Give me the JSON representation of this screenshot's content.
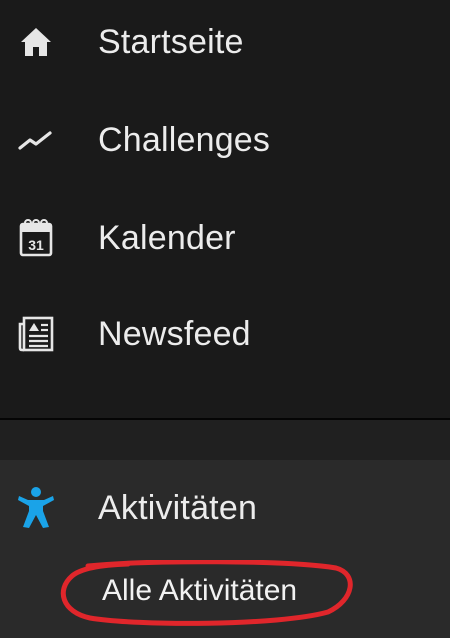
{
  "nav": {
    "items": [
      {
        "label": "Startseite",
        "icon": "home-icon"
      },
      {
        "label": "Challenges",
        "icon": "activity-line-icon"
      },
      {
        "label": "Kalender",
        "icon": "calendar-icon",
        "icon_text": "31"
      },
      {
        "label": "Newsfeed",
        "icon": "newsfeed-icon"
      }
    ]
  },
  "section": {
    "label": "Aktivitäten",
    "icon": "person-activity-icon",
    "icon_color": "#1aa3e8",
    "sub_items": [
      {
        "label": "Alle Aktivitäten"
      }
    ]
  },
  "annotation": {
    "color": "#e0262b"
  },
  "colors": {
    "background_top": "#1a1a1a",
    "background_section": "#2a2a2a",
    "text": "#ececec",
    "accent": "#1aa3e8"
  }
}
